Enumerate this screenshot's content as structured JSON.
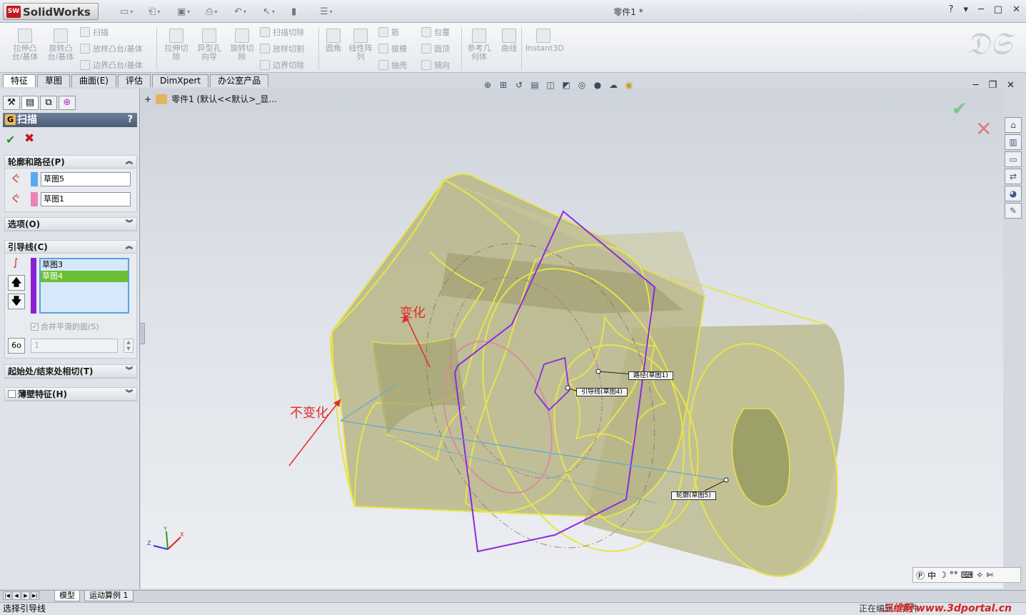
{
  "app": {
    "brand": "SolidWorks",
    "brand_badge": "SW",
    "doc_title": "零件1 *"
  },
  "quick_access": [
    "new",
    "open",
    "save",
    "print",
    "undo",
    "select",
    "rebuild",
    "options"
  ],
  "window_controls": [
    "?",
    "▾",
    "─",
    "□",
    "✕"
  ],
  "ribbon": {
    "big": [
      {
        "label": "拉伸凸\n台/基体"
      },
      {
        "label": "旋转凸\n台/基体"
      },
      {
        "label": "拉伸切\n除"
      },
      {
        "label": "异型孔\n向导"
      },
      {
        "label": "旋转切\n除"
      },
      {
        "label": "圆角"
      },
      {
        "label": "线性阵\n列"
      },
      {
        "label": "参考几\n何体"
      },
      {
        "label": "曲线"
      },
      {
        "label": "Instant3D"
      }
    ],
    "small": [
      {
        "label": "扫描"
      },
      {
        "label": "放样凸台/基体"
      },
      {
        "label": "边界凸台/基体"
      },
      {
        "label": "扫描切除"
      },
      {
        "label": "放样切割"
      },
      {
        "label": "边界切除"
      },
      {
        "label": "筋"
      },
      {
        "label": "拔模"
      },
      {
        "label": "抽壳"
      },
      {
        "label": "包覆"
      },
      {
        "label": "圆顶"
      },
      {
        "label": "镜向"
      }
    ]
  },
  "command_tabs": [
    "特征",
    "草图",
    "曲面(E)",
    "评估",
    "DimXpert",
    "办公室产品"
  ],
  "pm": {
    "title": "扫描",
    "help": "?",
    "ok": "✔",
    "cancel": "✖",
    "profile_path": {
      "header": "轮廓和路径(P)",
      "profile": "草图5",
      "path": "草图1",
      "profile_color": "#5aa9ee",
      "path_color": "#ee82b8"
    },
    "options": {
      "header": "选项(O)"
    },
    "guides": {
      "header": "引导线(C)",
      "items": [
        "草图3",
        "草图4"
      ],
      "selected_index": 1,
      "merge_label": "合并平滑的面(S)",
      "spin_value": "1"
    },
    "tangency": {
      "header": "起始处/结束处相切(T)"
    },
    "thin": {
      "header": "薄壁特征(H)"
    }
  },
  "tree": {
    "root": "零件1  (默认<<默认>_显..."
  },
  "graphics": {
    "callouts": {
      "path": "路径(草图1)",
      "guide": "引导线(草图4)",
      "profile": "轮廓(草图5)"
    },
    "annotations": {
      "change": "变化",
      "nochange": "不变化"
    },
    "triad": {
      "x": "X",
      "y": "Y",
      "z": "Z"
    }
  },
  "bottom": {
    "tabs": [
      "模型",
      "运动算例 1"
    ],
    "status_left": "选择引导线",
    "status_right": "正在编辑：零件",
    "watermark": "三维网 www.3dportal.cn"
  },
  "colors": {
    "title_bar": "#dfe3e9",
    "pm_header": "#5a6b84",
    "guide_selected": "#6cbf34",
    "guide_bar": "#8b1fd8",
    "body_fill": "#b5b482",
    "edge_yellow": "#e8e44a",
    "sketch_purple": "#8a2be2"
  }
}
